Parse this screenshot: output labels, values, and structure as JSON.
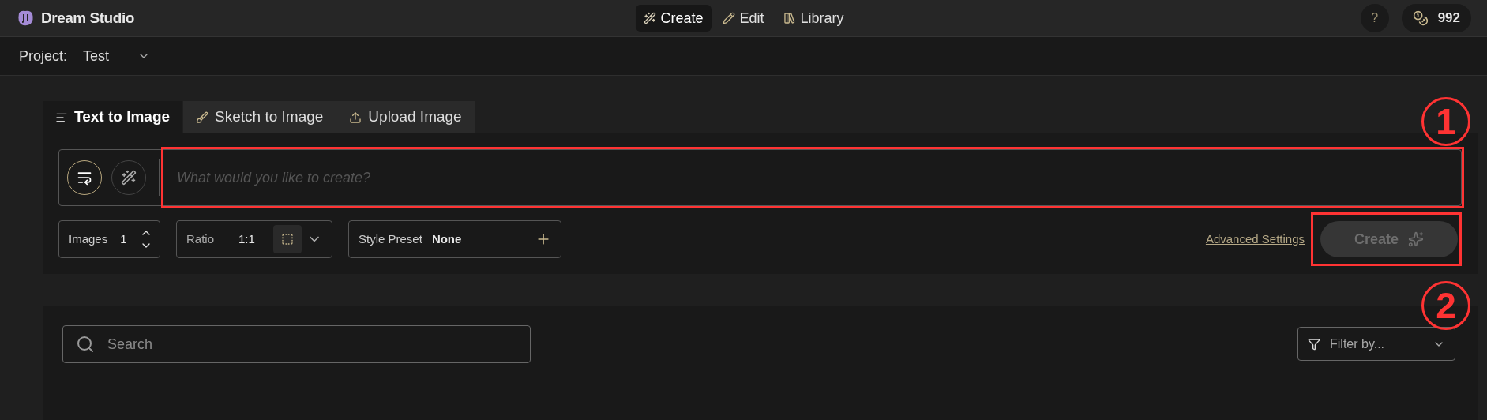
{
  "header": {
    "brand": "Dream Studio",
    "nav": [
      {
        "label": "Create",
        "selected": true,
        "kind": "wand"
      },
      {
        "label": "Edit",
        "selected": false,
        "kind": "pencil"
      },
      {
        "label": "Library",
        "selected": false,
        "kind": "books"
      }
    ],
    "help": "?",
    "credits": "992"
  },
  "project": {
    "label": "Project:",
    "value": "Test"
  },
  "tabs": [
    {
      "label": "Text to Image",
      "selected": true,
      "kind": "lines"
    },
    {
      "label": "Sketch to Image",
      "selected": false,
      "kind": "brush"
    },
    {
      "label": "Upload Image",
      "selected": false,
      "kind": "upload"
    }
  ],
  "prompt": {
    "placeholder": "What would you like to create?",
    "modes": [
      {
        "kind": "wrap",
        "selected": true
      },
      {
        "kind": "wand",
        "selected": false
      }
    ]
  },
  "options": {
    "images": {
      "label": "Images",
      "value": "1"
    },
    "ratio": {
      "label": "Ratio",
      "value": "1:1"
    },
    "style_preset": {
      "label": "Style Preset",
      "value": "None"
    }
  },
  "advanced_link": "Advanced Settings",
  "create_button": {
    "label": "Create",
    "disabled": true
  },
  "annotations": [
    {
      "label": "1"
    },
    {
      "label": "2"
    }
  ],
  "gallery": {
    "search": {
      "placeholder": "Search"
    },
    "filter": {
      "placeholder": "Filter by..."
    }
  }
}
